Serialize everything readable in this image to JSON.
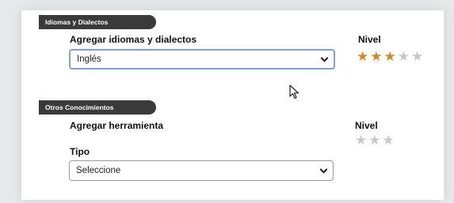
{
  "sections": {
    "idiomas": {
      "tab": "Idiomas y Dialectos",
      "add_label": "Agregar idiomas y dialectos",
      "select_value": "Inglés",
      "level_label": "Nivel",
      "rating": 3,
      "max_rating": 5
    },
    "otros": {
      "tab": "Otros Conocimientos",
      "add_label": "Agregar herramienta",
      "level_label": "Nivel",
      "rating": 0,
      "max_rating": 3,
      "type_label": "Tipo",
      "select_value": "Seleccione"
    }
  },
  "colors": {
    "star_on": "#d4891e",
    "star_off": "#c8c8c8",
    "tab_bg": "#3a3a3a",
    "focus_border": "#7aa0dd"
  },
  "icons": {
    "star": "star-icon",
    "chevron": "chevron-down-icon",
    "cursor": "mouse-pointer-icon"
  }
}
